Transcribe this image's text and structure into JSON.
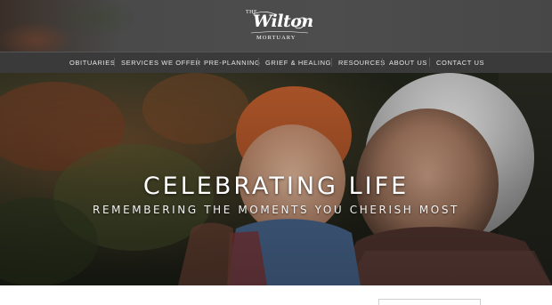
{
  "header": {
    "logo": {
      "the": "THE",
      "name": "Wilton",
      "sub": "MORTUARY"
    }
  },
  "nav": {
    "items": [
      {
        "label": "OBITUARIES"
      },
      {
        "label": "SERVICES WE OFFER"
      },
      {
        "label": "PRE-PLANNING"
      },
      {
        "label": "GRIEF & HEALING"
      },
      {
        "label": "RESOURCES"
      },
      {
        "label": "ABOUT US"
      },
      {
        "label": "CONTACT US"
      }
    ]
  },
  "hero": {
    "title": "CELEBRATING LIFE",
    "subtitle": "REMEMBERING THE MOMENTS YOU CHERISH MOST"
  },
  "colors": {
    "header_bg": "#4a4a4a",
    "nav_bg": "#3a3a3a",
    "text_light": "#ffffff"
  }
}
